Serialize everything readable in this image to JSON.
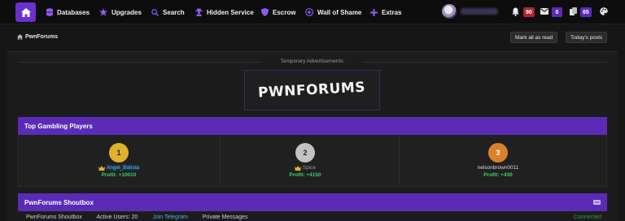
{
  "nav": {
    "items": [
      {
        "label": "Databases",
        "icon": "database-icon"
      },
      {
        "label": "Upgrades",
        "icon": "star-icon"
      },
      {
        "label": "Search",
        "icon": "search-icon"
      },
      {
        "label": "Hidden Service",
        "icon": "user-secret-icon"
      },
      {
        "label": "Escrow",
        "icon": "shield-icon"
      },
      {
        "label": "Wall of Shame",
        "icon": "target-icon"
      },
      {
        "label": "Extras",
        "icon": "plus-icon"
      }
    ],
    "notifications_count": "90",
    "messages_count": "0",
    "copies_count": "65"
  },
  "breadcrumb": {
    "label": "PwnForums"
  },
  "actions": {
    "mark_read": "Mark all as read",
    "todays_posts": "Today's posts"
  },
  "ads": {
    "label": "Temporary Advertisements:",
    "banner_text": "PWNFORUMS"
  },
  "gambling": {
    "title": "Top Gambling Players",
    "players": [
      {
        "rank": "1",
        "name": "Angel_Batista",
        "profit": "Profit: +10010",
        "rank_color": "#e1b12c",
        "name_color": "#4fa9e8",
        "crown": true
      },
      {
        "rank": "2",
        "name": "Spice",
        "profit": "Profit: +4150",
        "rank_color": "#c2c2c2",
        "name_color": "#9a9a9a",
        "crown": true
      },
      {
        "rank": "3",
        "name": "nelsonbrown0011",
        "profit": "Profit: +430",
        "rank_color": "#d9822b",
        "name_color": "#d8d8d8",
        "crown": false
      }
    ]
  },
  "shoutbox": {
    "title": "PwnForums Shoutbox",
    "tabs": [
      "PwnForums Shoutbox",
      "Active Users: 20",
      "Join Telegram",
      "Private Messages"
    ],
    "status": "Connected"
  },
  "colors": {
    "accent": "#5b2bb8",
    "profit": "#3ecf6c"
  }
}
